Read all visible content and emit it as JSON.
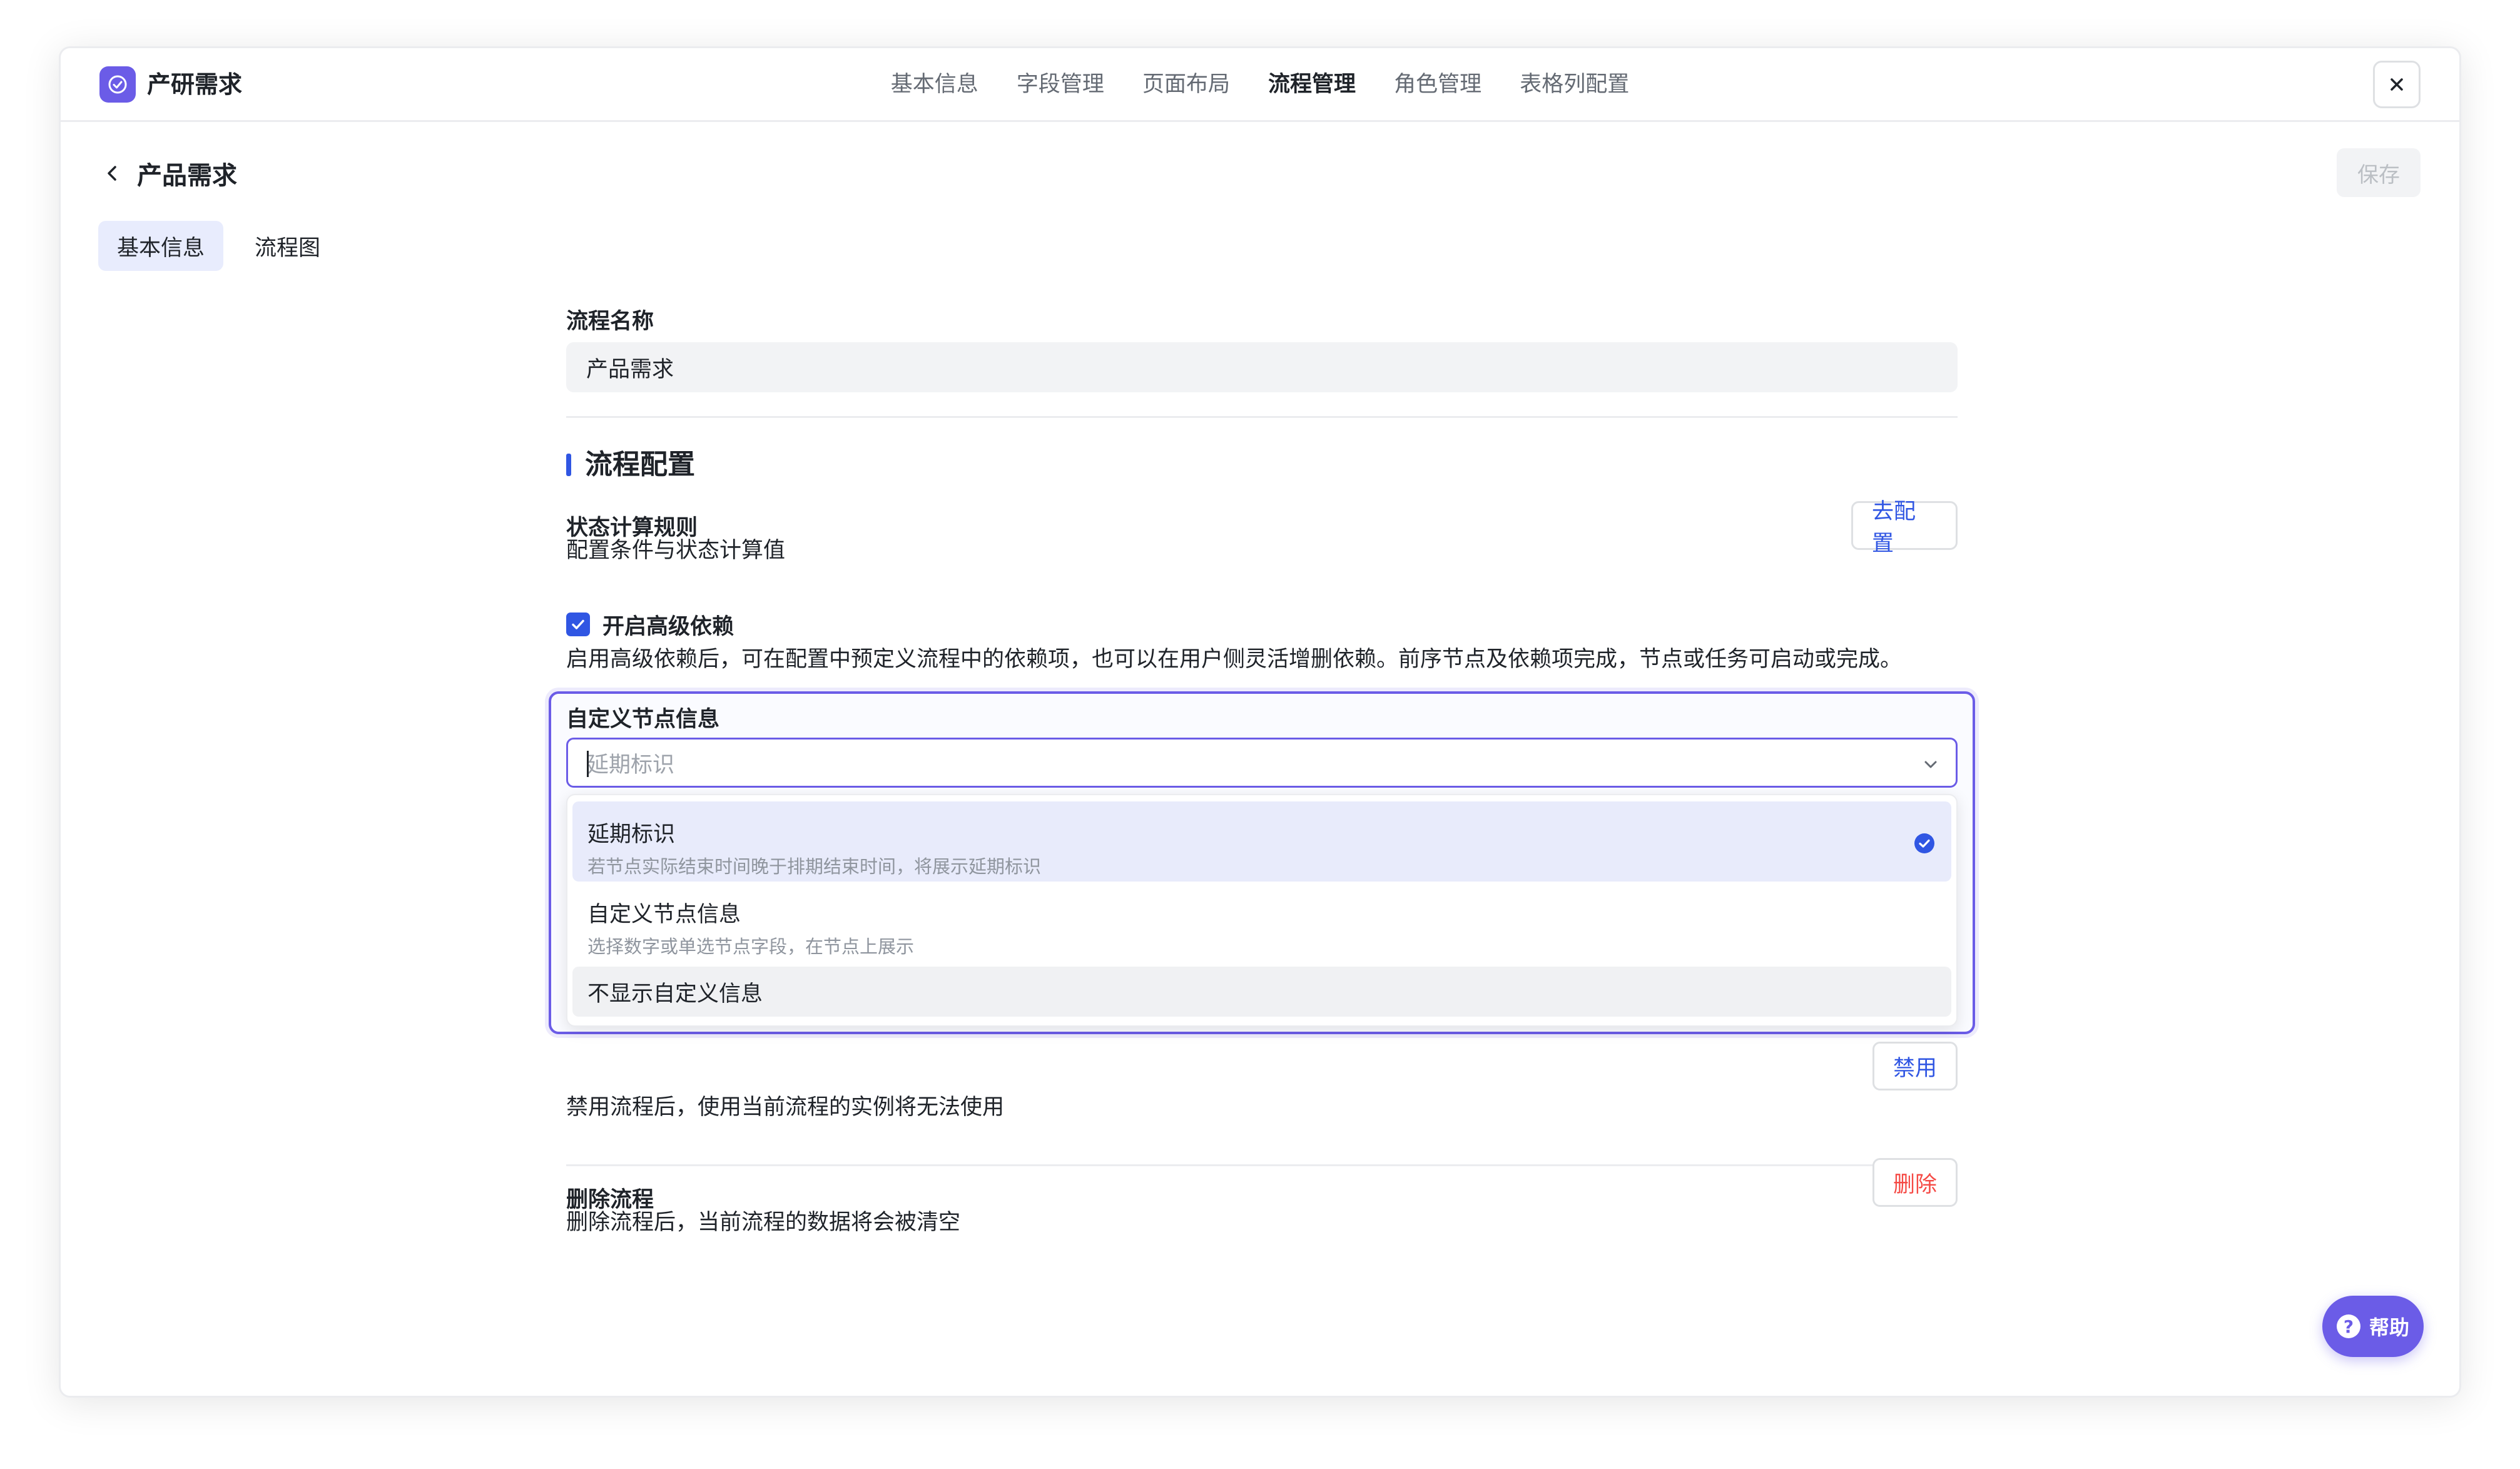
{
  "app": {
    "name": "产研需求"
  },
  "top_tabs": [
    {
      "label": "基本信息"
    },
    {
      "label": "字段管理"
    },
    {
      "label": "页面布局"
    },
    {
      "label": "流程管理",
      "active": true
    },
    {
      "label": "角色管理"
    },
    {
      "label": "表格列配置"
    }
  ],
  "page": {
    "title": "产品需求",
    "save_label": "保存"
  },
  "sub_tabs": [
    {
      "label": "基本信息",
      "active": true
    },
    {
      "label": "流程图"
    }
  ],
  "process_name": {
    "label": "流程名称",
    "value": "产品需求"
  },
  "config": {
    "section_title": "流程配置",
    "status_rule": {
      "title": "状态计算规则",
      "desc": "配置条件与状态计算值",
      "button": "去配置"
    },
    "advanced": {
      "label": "开启高级依赖",
      "checked": true,
      "desc": "启用高级依赖后，可在配置中预定义流程中的依赖项，也可以在用户侧灵活增删依赖。前序节点及依赖项完成，节点或任务可启动或完成。"
    },
    "custom_node": {
      "label": "自定义节点信息",
      "placeholder": "延期标识",
      "options": [
        {
          "title": "延期标识",
          "desc": "若节点实际结束时间晚于排期结束时间，将展示延期标识",
          "selected": true
        },
        {
          "title": "自定义节点信息",
          "desc": "选择数字或单选节点字段，在节点上展示"
        },
        {
          "title": "不显示自定义信息"
        }
      ]
    },
    "disable": {
      "desc": "禁用流程后，使用当前流程的实例将无法使用",
      "button": "禁用"
    },
    "delete": {
      "title": "删除流程",
      "desc": "删除流程后，当前流程的数据将会被清空",
      "button": "删除"
    }
  },
  "help": {
    "label": "帮助"
  },
  "colors": {
    "accent": "#3056e3",
    "brand": "#6b5ce7",
    "danger": "#f54a45"
  },
  "icons": [
    "check-circle-icon",
    "close-icon",
    "chevron-left-icon",
    "chevron-down-icon",
    "check-icon",
    "question-icon"
  ]
}
